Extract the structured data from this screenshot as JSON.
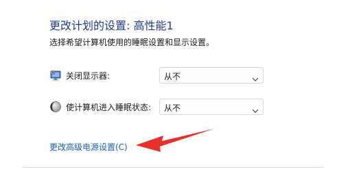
{
  "header": {
    "title": "更改计划的设置: 高性能1",
    "subtitle": "选择希望计算机使用的睡眠设置和显示设置。"
  },
  "settings": [
    {
      "label": "关闭显示器:",
      "value": "从不",
      "icon": "monitor-icon"
    },
    {
      "label": "使计算机进入睡眠状态:",
      "value": "从不",
      "icon": "moon-icon"
    }
  ],
  "links": {
    "advanced": "更改高级电源设置(C)"
  },
  "colors": {
    "title": "#1e3c8c",
    "link": "#1a5fb4",
    "arrow": "#e8302a"
  }
}
